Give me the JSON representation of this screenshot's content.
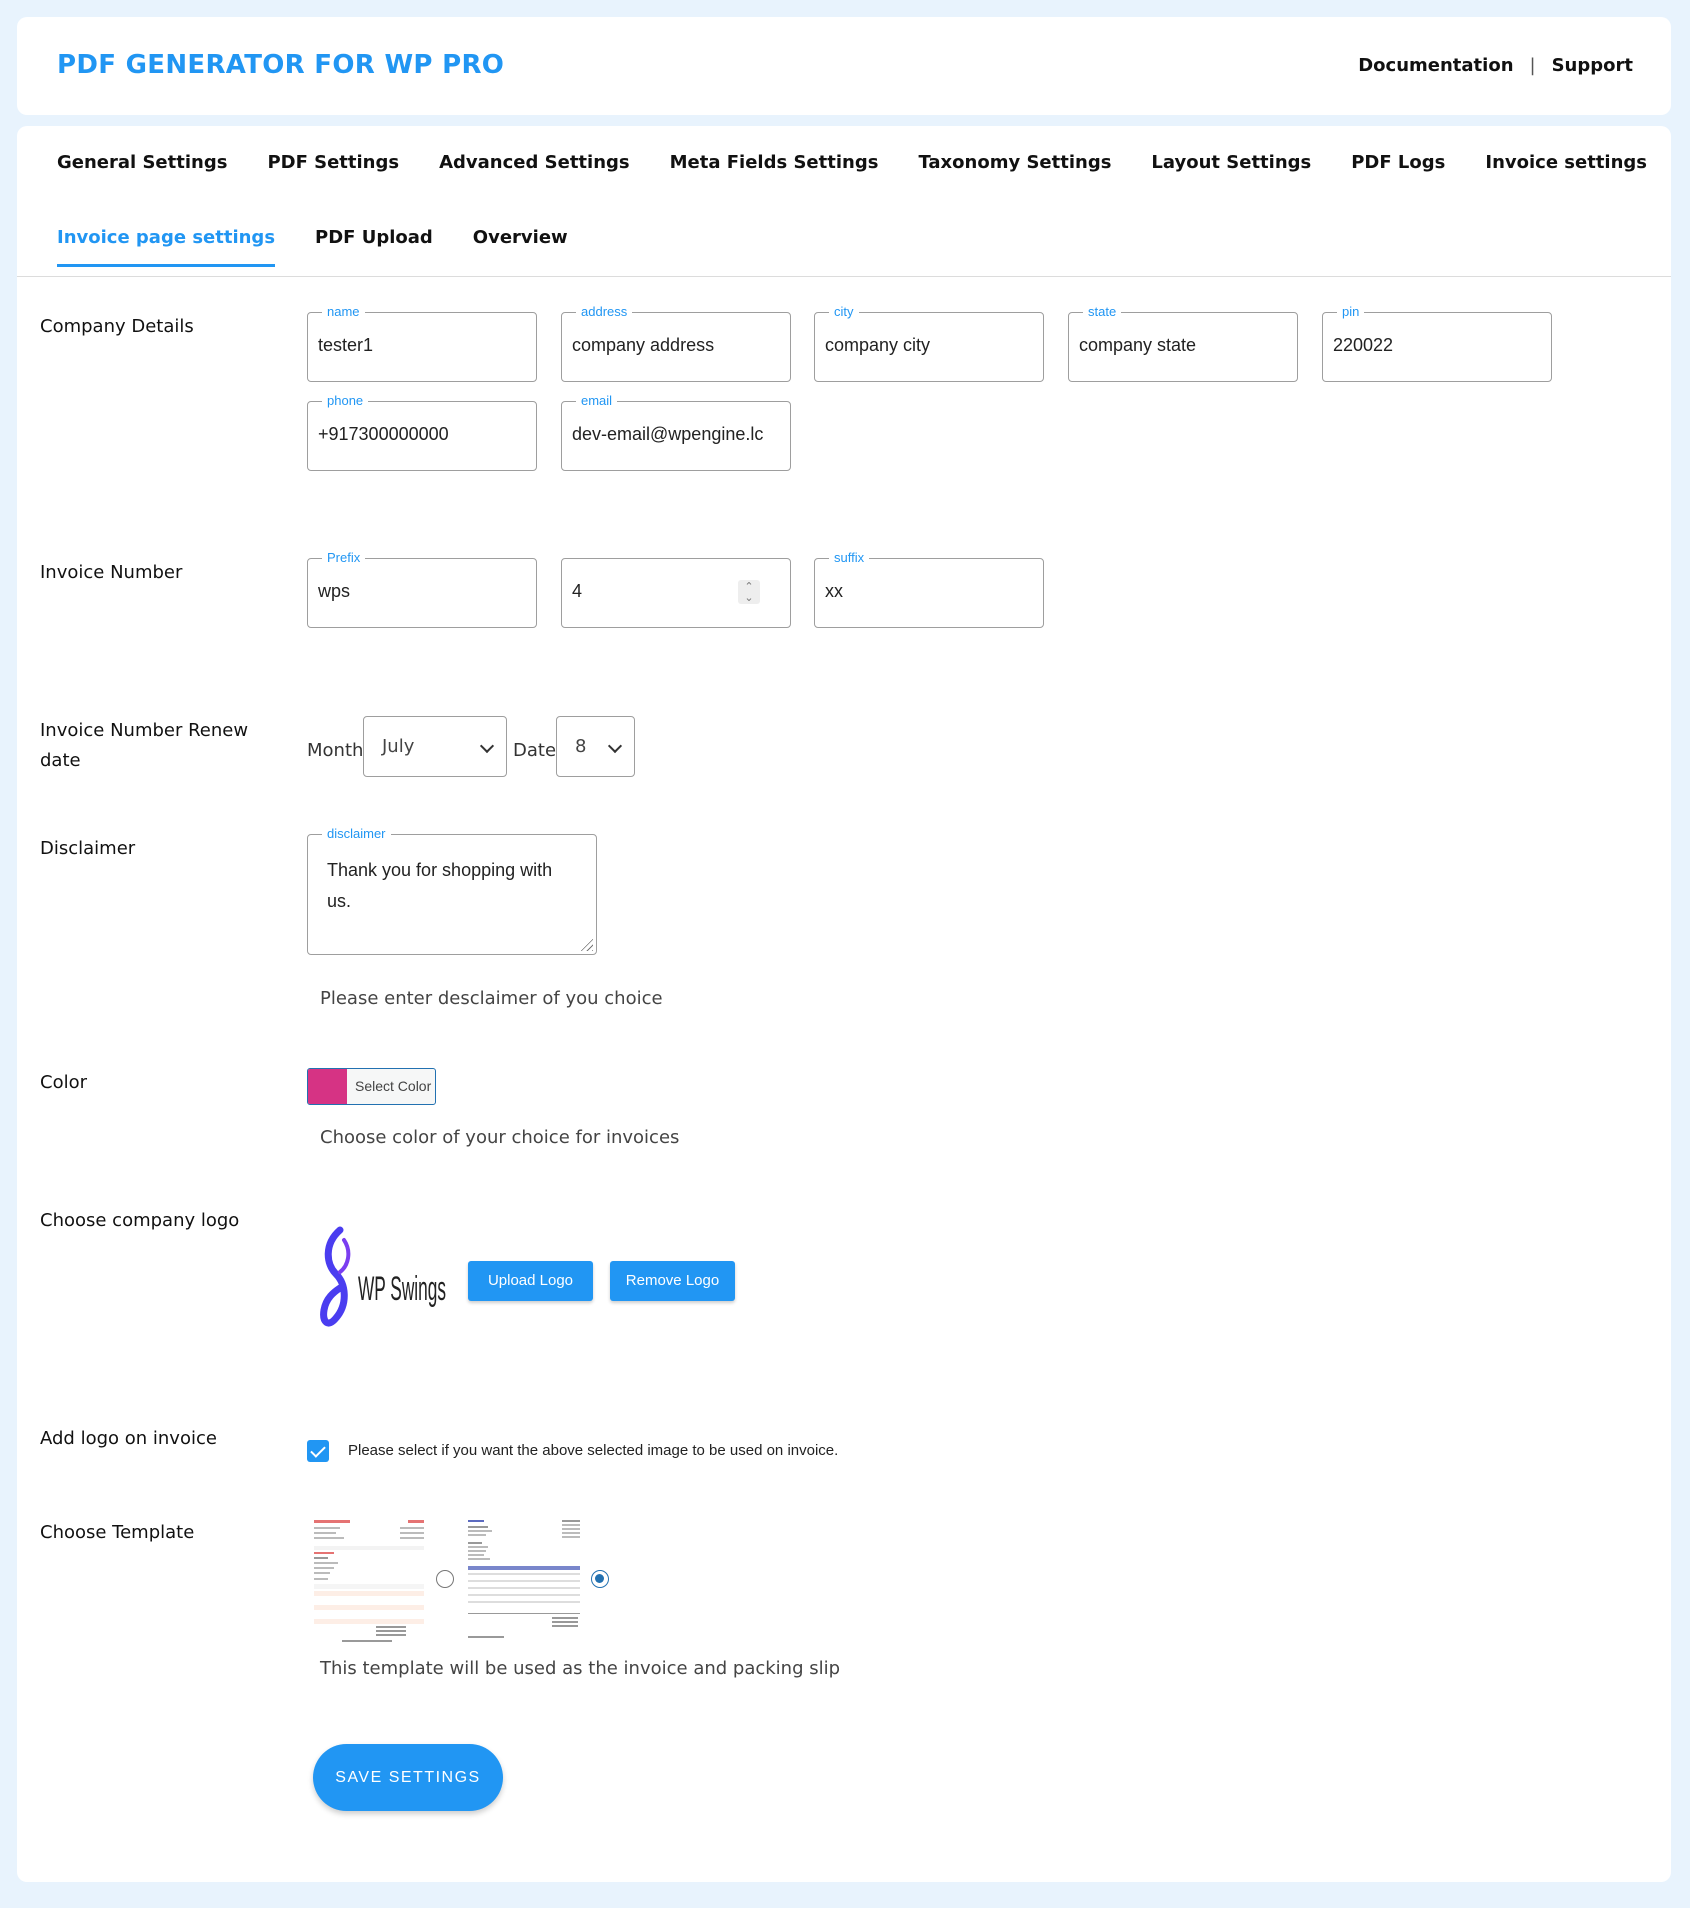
{
  "header": {
    "brand": "PDF GENERATOR FOR WP PRO",
    "links": {
      "documentation": "Documentation",
      "separator": "|",
      "support": "Support"
    }
  },
  "nav": {
    "row1": [
      "General Settings",
      "PDF Settings",
      "Advanced Settings",
      "Meta Fields Settings",
      "Taxonomy Settings",
      "Layout Settings",
      "PDF Logs",
      "Invoice settings"
    ],
    "row2": [
      "Invoice page settings",
      "PDF Upload",
      "Overview"
    ],
    "active": "Invoice page settings"
  },
  "company_details": {
    "label": "Company Details",
    "fields": {
      "name": {
        "legend": "name",
        "value": "tester1"
      },
      "address": {
        "legend": "address",
        "value": "company address"
      },
      "city": {
        "legend": "city",
        "value": "company city"
      },
      "state": {
        "legend": "state",
        "value": "company state"
      },
      "pin": {
        "legend": "pin",
        "value": "220022"
      },
      "phone": {
        "legend": "phone",
        "value": "+917300000000"
      },
      "email": {
        "legend": "email",
        "value": "dev-email@wpengine.lc"
      }
    }
  },
  "invoice_number": {
    "label": "Invoice Number",
    "prefix": {
      "legend": "Prefix",
      "value": "wps"
    },
    "number": {
      "value": "4"
    },
    "suffix": {
      "legend": "suffix",
      "value": "xx"
    }
  },
  "renew_date": {
    "label": "Invoice Number Renew date",
    "month_label": "Month",
    "month_value": "July",
    "date_label": "Date",
    "date_value": "8"
  },
  "disclaimer": {
    "label": "Disclaimer",
    "legend": "disclaimer",
    "value": "Thank you for shopping with us.",
    "help": "Please enter desclaimer of you choice"
  },
  "color": {
    "label": "Color",
    "swatch": "#d63384",
    "button_label": "Select Color",
    "help": "Choose color of your choice for invoices"
  },
  "logo": {
    "label": "Choose company logo",
    "image_text": "WP Swings",
    "upload_label": "Upload Logo",
    "remove_label": "Remove Logo"
  },
  "add_logo": {
    "label": "Add logo on invoice",
    "checked": true,
    "text": "Please select if you want the above selected image to be used on invoice."
  },
  "template": {
    "label": "Choose Template",
    "options": [
      {
        "name": "template-one",
        "selected": false
      },
      {
        "name": "template-two",
        "selected": true
      }
    ],
    "help": "This template will be used as the invoice and packing slip"
  },
  "save_label": "SAVE SETTINGS",
  "colors": {
    "accent": "#2196f3",
    "page_bg": "#e8f3fd"
  }
}
